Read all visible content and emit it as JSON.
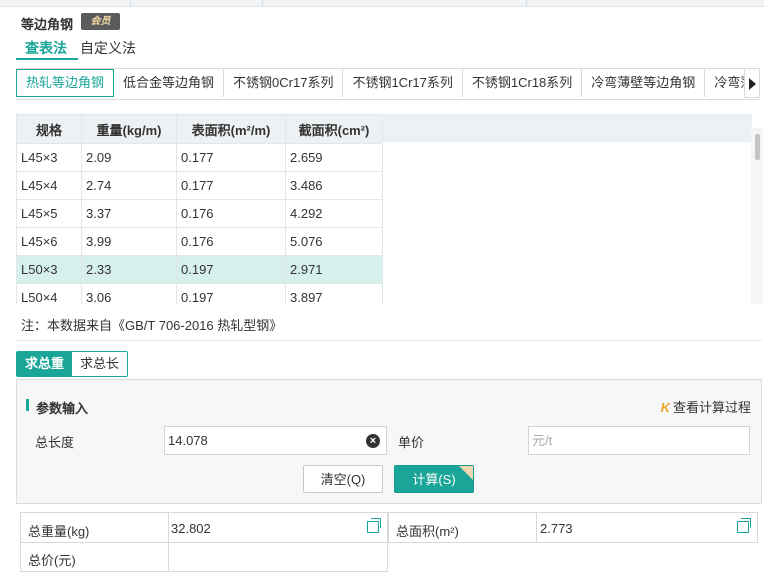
{
  "header": {
    "title": "等边角钢",
    "vip_badge": "会员",
    "tabs": [
      "查表法",
      "自定义法"
    ]
  },
  "material_tabs": [
    "热轧等边角钢",
    "低合金等边角钢",
    "不锈钢0Cr17系列",
    "不锈钢1Cr17系列",
    "不锈钢1Cr18系列",
    "冷弯薄壁等边角钢",
    "冷弯薄"
  ],
  "table": {
    "columns": [
      "规格",
      "重量(kg/m)",
      "表面积(m²/m)",
      "截面积(cm²)"
    ],
    "rows": [
      [
        "L45×3",
        "2.09",
        "0.177",
        "2.659"
      ],
      [
        "L45×4",
        "2.74",
        "0.177",
        "3.486"
      ],
      [
        "L45×5",
        "3.37",
        "0.176",
        "4.292"
      ],
      [
        "L45×6",
        "3.99",
        "0.176",
        "5.076"
      ],
      [
        "L50×3",
        "2.33",
        "0.197",
        "2.971"
      ],
      [
        "L50×4",
        "3.06",
        "0.197",
        "3.897"
      ]
    ],
    "selected_row": 4
  },
  "note": "注：本数据来自《GB/T  706-2016  热轧型钢》",
  "mode_tabs": {
    "total_weight": "求总重",
    "total_length": "求总长"
  },
  "params": {
    "title": "参数输入",
    "view_process": "查看计算过程",
    "length_label": "总长度",
    "length_value": "14.078",
    "price_label": "单价",
    "price_placeholder": "元/t",
    "clear_button": "清空(Q)",
    "calc_button": "计算(S)"
  },
  "results": {
    "weight_label": "总重量(kg)",
    "weight_value": "32.802",
    "area_label": "总面积(m²)",
    "area_value": "2.773",
    "price_label": "总价(元)",
    "price_value": ""
  },
  "colors": {
    "accent": "#19a598",
    "selected_row": "#d6f0ec"
  }
}
